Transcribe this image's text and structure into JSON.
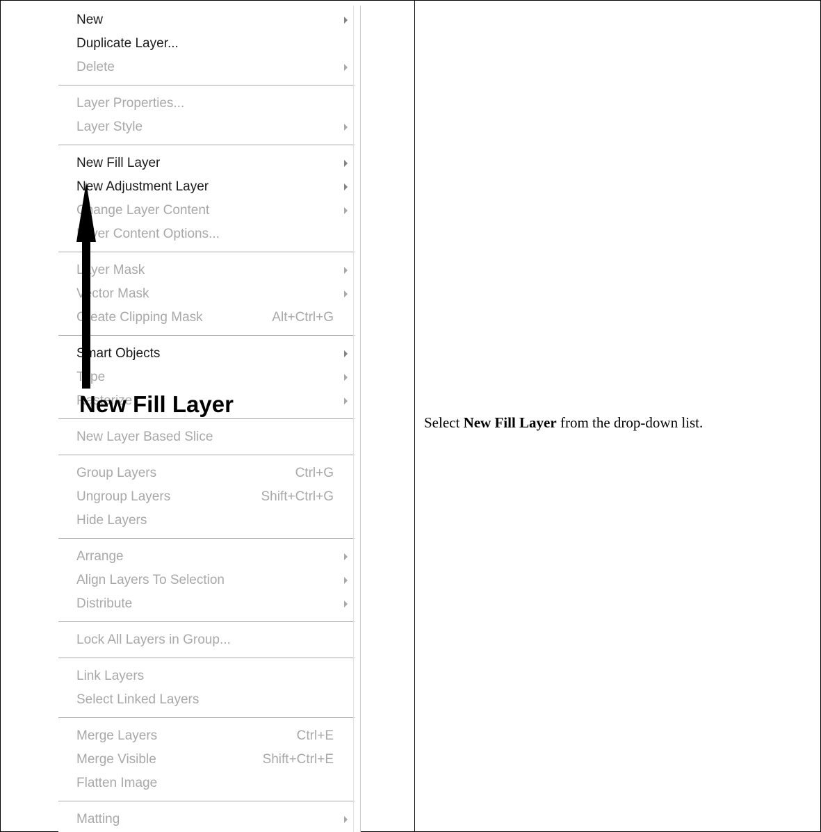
{
  "menu": {
    "items": [
      {
        "label": "New",
        "shortcut": "",
        "submenu": true,
        "enabled": true
      },
      {
        "label": "Duplicate Layer...",
        "shortcut": "",
        "submenu": false,
        "enabled": true
      },
      {
        "label": "Delete",
        "shortcut": "",
        "submenu": true,
        "enabled": false
      },
      {
        "separator": true
      },
      {
        "label": "Layer Properties...",
        "shortcut": "",
        "submenu": false,
        "enabled": false
      },
      {
        "label": "Layer Style",
        "shortcut": "",
        "submenu": true,
        "enabled": false
      },
      {
        "separator": true
      },
      {
        "label": "New Fill Layer",
        "shortcut": "",
        "submenu": true,
        "enabled": true
      },
      {
        "label": "New Adjustment Layer",
        "shortcut": "",
        "submenu": true,
        "enabled": true
      },
      {
        "label": "Change Layer Content",
        "shortcut": "",
        "submenu": true,
        "enabled": false
      },
      {
        "label": "Layer Content Options...",
        "shortcut": "",
        "submenu": false,
        "enabled": false
      },
      {
        "separator": true
      },
      {
        "label": "Layer Mask",
        "shortcut": "",
        "submenu": true,
        "enabled": false
      },
      {
        "label": "Vector Mask",
        "shortcut": "",
        "submenu": true,
        "enabled": false
      },
      {
        "label": "Create Clipping Mask",
        "shortcut": "Alt+Ctrl+G",
        "submenu": false,
        "enabled": false
      },
      {
        "separator": true
      },
      {
        "label": "Smart Objects",
        "shortcut": "",
        "submenu": true,
        "enabled": true
      },
      {
        "label": "Type",
        "shortcut": "",
        "submenu": true,
        "enabled": false
      },
      {
        "label": "Rasterize",
        "shortcut": "",
        "submenu": true,
        "enabled": false
      },
      {
        "separator": true
      },
      {
        "label": "New Layer Based Slice",
        "shortcut": "",
        "submenu": false,
        "enabled": false
      },
      {
        "separator": true
      },
      {
        "label": "Group Layers",
        "shortcut": "Ctrl+G",
        "submenu": false,
        "enabled": false
      },
      {
        "label": "Ungroup Layers",
        "shortcut": "Shift+Ctrl+G",
        "submenu": false,
        "enabled": false
      },
      {
        "label": "Hide Layers",
        "shortcut": "",
        "submenu": false,
        "enabled": false
      },
      {
        "separator": true
      },
      {
        "label": "Arrange",
        "shortcut": "",
        "submenu": true,
        "enabled": false
      },
      {
        "label": "Align Layers To Selection",
        "shortcut": "",
        "submenu": true,
        "enabled": false
      },
      {
        "label": "Distribute",
        "shortcut": "",
        "submenu": true,
        "enabled": false
      },
      {
        "separator": true
      },
      {
        "label": "Lock All Layers in Group...",
        "shortcut": "",
        "submenu": false,
        "enabled": false
      },
      {
        "separator": true
      },
      {
        "label": "Link Layers",
        "shortcut": "",
        "submenu": false,
        "enabled": false
      },
      {
        "label": "Select Linked Layers",
        "shortcut": "",
        "submenu": false,
        "enabled": false
      },
      {
        "separator": true
      },
      {
        "label": "Merge Layers",
        "shortcut": "Ctrl+E",
        "submenu": false,
        "enabled": false
      },
      {
        "label": "Merge Visible",
        "shortcut": "Shift+Ctrl+E",
        "submenu": false,
        "enabled": false
      },
      {
        "label": "Flatten Image",
        "shortcut": "",
        "submenu": false,
        "enabled": false
      },
      {
        "separator": true
      },
      {
        "label": "Matting",
        "shortcut": "",
        "submenu": true,
        "enabled": false
      }
    ]
  },
  "callout": {
    "label": "New Fill Layer",
    "arrow_icon": "up-arrow-icon",
    "color": "#000000"
  },
  "instruction": {
    "prefix": "Select ",
    "bold": "New Fill Layer",
    "suffix": " from the drop-down list."
  },
  "colors": {
    "enabled_text": "#1a1a1a",
    "disabled_text": "#a8a8a8",
    "separator": "#a6a6a6",
    "border": "#000000"
  }
}
